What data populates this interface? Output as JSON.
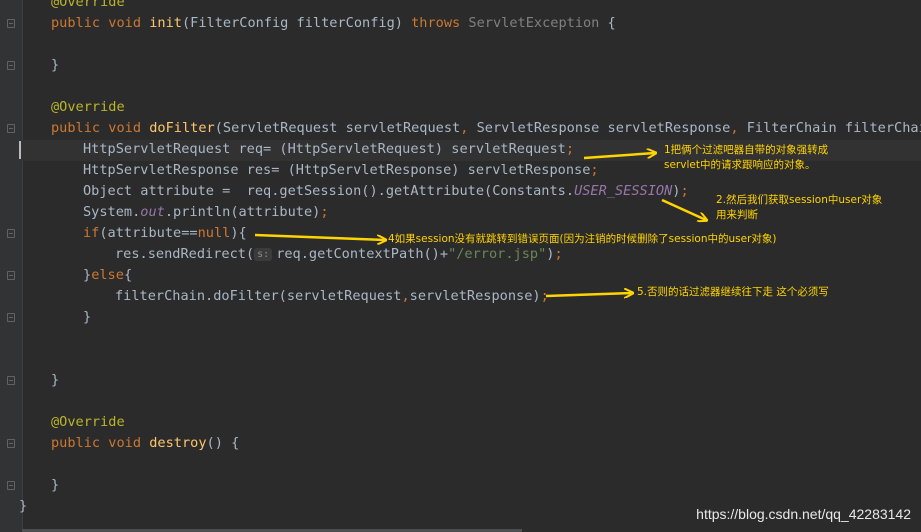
{
  "editor": {
    "lines": [
      {
        "id": "override-1",
        "segments": [
          {
            "t": "@Override",
            "c": "ann"
          }
        ]
      },
      {
        "id": "init-signature",
        "segments": [
          {
            "t": "public void ",
            "c": "kw"
          },
          {
            "t": "init",
            "c": "fn"
          },
          {
            "t": "(FilterConfig filterConfig) "
          },
          {
            "t": "throws ",
            "c": "kw"
          },
          {
            "t": "ServletException",
            "c": "dim"
          },
          {
            "t": " {"
          }
        ]
      },
      {
        "id": "init-close",
        "segments": [
          {
            "t": "}"
          }
        ]
      },
      {
        "id": "override-2",
        "segments": [
          {
            "t": "@Override",
            "c": "ann"
          }
        ]
      },
      {
        "id": "dofilter-signature",
        "segments": [
          {
            "t": "public void ",
            "c": "kw"
          },
          {
            "t": "doFilter",
            "c": "fn"
          },
          {
            "t": "(ServletRequest servletRequest"
          },
          {
            "t": ", ",
            "c": "kw"
          },
          {
            "t": "ServletResponse servletResponse"
          },
          {
            "t": ", ",
            "c": "kw"
          },
          {
            "t": "FilterChain filterChain) "
          }
        ]
      },
      {
        "id": "cast-request",
        "segments": [
          {
            "t": "HttpServletRequest req= (HttpServletRequest) servletRequest"
          },
          {
            "t": ";",
            "c": "kw"
          }
        ]
      },
      {
        "id": "cast-response",
        "segments": [
          {
            "t": "HttpServletResponse res= (HttpServletResponse) servletResponse"
          },
          {
            "t": ";",
            "c": "kw"
          }
        ]
      },
      {
        "id": "get-attribute",
        "segments": [
          {
            "t": "Object attribute =  req.getSession().getAttribute(Constants."
          },
          {
            "t": "USER_SESSION",
            "c": "ital"
          },
          {
            "t": ")"
          },
          {
            "t": ";",
            "c": "kw"
          }
        ]
      },
      {
        "id": "println",
        "segments": [
          {
            "t": "System."
          },
          {
            "t": "out",
            "c": "ital"
          },
          {
            "t": ".println(attribute)"
          },
          {
            "t": ";",
            "c": "kw"
          }
        ]
      },
      {
        "id": "if-null",
        "segments": [
          {
            "t": "if",
            "c": "kw"
          },
          {
            "t": "(attribute=="
          },
          {
            "t": "null",
            "c": "kw"
          },
          {
            "t": "){"
          }
        ]
      },
      {
        "id": "send-redirect",
        "segments": [
          {
            "t": "res.sendRedirect("
          },
          {
            "hint": "s:"
          },
          {
            "t": "req.getContextPath()+"
          },
          {
            "t": "\"/error.jsp\"",
            "c": "str"
          },
          {
            "t": ")"
          },
          {
            "t": ";",
            "c": "kw"
          }
        ]
      },
      {
        "id": "else",
        "segments": [
          {
            "t": "}"
          },
          {
            "t": "else",
            "c": "kw"
          },
          {
            "t": "{"
          }
        ]
      },
      {
        "id": "chain-dofilter",
        "segments": [
          {
            "t": "filterChain.doFilter(servletRequest"
          },
          {
            "t": ",",
            "c": "kw"
          },
          {
            "t": "servletResponse)"
          },
          {
            "t": ";",
            "c": "kw"
          }
        ]
      },
      {
        "id": "if-close",
        "segments": [
          {
            "t": "}"
          }
        ]
      },
      {
        "id": "dofilter-close",
        "segments": [
          {
            "t": "}"
          }
        ]
      },
      {
        "id": "override-3",
        "segments": [
          {
            "t": "@Override",
            "c": "ann"
          }
        ]
      },
      {
        "id": "destroy-signature",
        "segments": [
          {
            "t": "public void ",
            "c": "kw"
          },
          {
            "t": "destroy",
            "c": "fn"
          },
          {
            "t": "() {"
          }
        ]
      },
      {
        "id": "destroy-close",
        "segments": [
          {
            "t": "}"
          }
        ]
      },
      {
        "id": "class-close",
        "segments": [
          {
            "t": "}"
          }
        ]
      }
    ]
  },
  "annotations": {
    "note1_line1": "1把俩个过滤吧器自带的对象强转成",
    "note1_line2": "servlet中的请求跟响应的对象。",
    "note2_line1": "2.然后我们获取session中user对象",
    "note2_line2": "用来判断",
    "note4": "4如果session没有就跳转到错误页面(因为注销的时候删除了session中的user对象)",
    "note5": "5.否则的话过滤器继续往下走 这个必须写"
  },
  "watermark": "https://blog.csdn.net/qq_42283142",
  "colors": {
    "background": "#2b2b2b",
    "annotation_arrow": "#ffd400",
    "keyword": "#cc7832",
    "method": "#ffc66d",
    "string": "#6a8759"
  }
}
